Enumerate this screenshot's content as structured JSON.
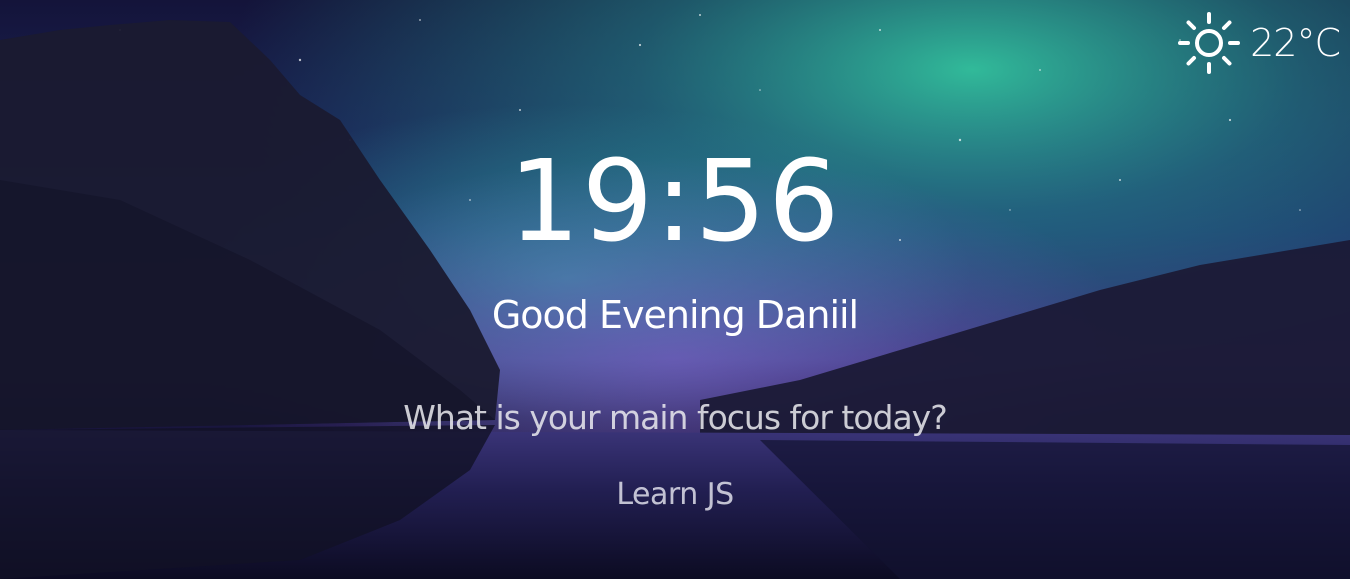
{
  "weather": {
    "icon": "sun-icon",
    "temperature": "22°C"
  },
  "clock": {
    "time": "19:56"
  },
  "greeting": {
    "text": "Good Evening Daniil"
  },
  "focus": {
    "question": "What is your main focus for today?",
    "value": "Learn JS"
  },
  "colors": {
    "text": "#ffffff",
    "aurora_green": "#2fc7a0",
    "sky_purple": "#4a2f8f",
    "night": "#0e0d28"
  }
}
